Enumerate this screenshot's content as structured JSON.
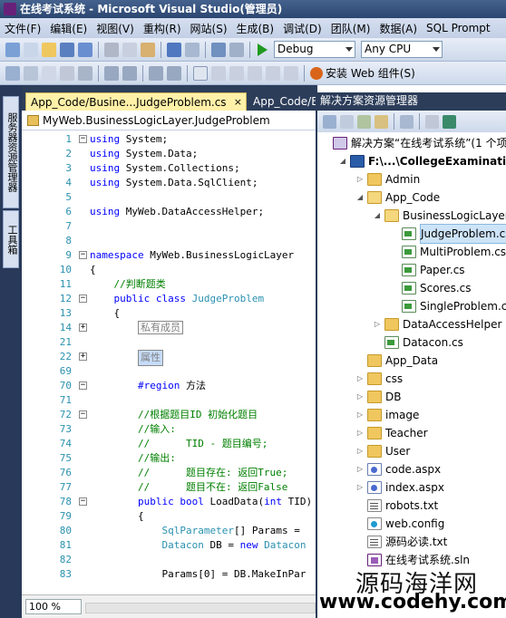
{
  "window": {
    "title": "在线考试系统 - Microsoft Visual Studio(管理员)"
  },
  "menu": [
    "文件(F)",
    "编辑(E)",
    "视图(V)",
    "重构(R)",
    "网站(S)",
    "生成(B)",
    "调试(D)",
    "团队(M)",
    "数据(A)",
    "SQL Prompt"
  ],
  "toolbar": {
    "config": "Debug",
    "platform": "Any CPU",
    "install_web": "安装 Web 组件(S)"
  },
  "side_tabs": {
    "server_explorer": "服务器资源管理器",
    "toolbox": "工具箱"
  },
  "editor": {
    "active_tab": "App_Code/Busine...JudgeProblem.cs",
    "other_tab": "App_Code/B",
    "close": "×",
    "nav": "MyWeb.BusinessLogicLayer.JudgeProblem",
    "lines": [
      {
        "n": "1",
        "f": "−",
        "t": "using System;"
      },
      {
        "n": "2",
        "f": "",
        "t": "using System.Data;"
      },
      {
        "n": "3",
        "f": "",
        "t": "using System.Collections;"
      },
      {
        "n": "4",
        "f": "",
        "t": "using System.Data.SqlClient;"
      },
      {
        "n": "5",
        "f": "",
        "t": ""
      },
      {
        "n": "6",
        "f": "",
        "t": "using MyWeb.DataAccessHelper;"
      },
      {
        "n": "7",
        "f": "",
        "t": ""
      },
      {
        "n": "8",
        "f": "",
        "t": ""
      },
      {
        "n": "9",
        "f": "−",
        "t": "namespace MyWeb.BusinessLogicLayer"
      },
      {
        "n": "10",
        "f": "",
        "t": "{"
      },
      {
        "n": "11",
        "f": "",
        "t": "    //判断题类"
      },
      {
        "n": "12",
        "f": "−",
        "t": "    public class JudgeProblem"
      },
      {
        "n": "13",
        "f": "",
        "t": "    {"
      },
      {
        "n": "14",
        "f": "+",
        "t": "        私有成员"
      },
      {
        "n": "21",
        "f": "",
        "t": ""
      },
      {
        "n": "22",
        "f": "+",
        "t": "        属性"
      },
      {
        "n": "69",
        "f": "",
        "t": ""
      },
      {
        "n": "70",
        "f": "−",
        "t": "        #region 方法"
      },
      {
        "n": "71",
        "f": "",
        "t": ""
      },
      {
        "n": "72",
        "f": "−",
        "t": "        //根据题目ID 初始化题目"
      },
      {
        "n": "73",
        "f": "",
        "t": "        //输入:"
      },
      {
        "n": "74",
        "f": "",
        "t": "        //      TID - 题目编号;"
      },
      {
        "n": "75",
        "f": "",
        "t": "        //输出:"
      },
      {
        "n": "76",
        "f": "",
        "t": "        //      题目存在: 返回True;"
      },
      {
        "n": "77",
        "f": "",
        "t": "        //      题目不在: 返回False"
      },
      {
        "n": "78",
        "f": "−",
        "t": "        public bool LoadData(int TID)"
      },
      {
        "n": "79",
        "f": "",
        "t": "        {"
      },
      {
        "n": "80",
        "f": "",
        "t": "            SqlParameter[] Params ="
      },
      {
        "n": "81",
        "f": "",
        "t": "            Datacon DB = new Datacon"
      },
      {
        "n": "82",
        "f": "",
        "t": ""
      },
      {
        "n": "83",
        "f": "",
        "t": "            Params[0] = DB.MakeInPar"
      }
    ],
    "zoom": "100 %"
  },
  "solution_explorer": {
    "title": "解决方案资源管理器",
    "items": [
      {
        "label": "解决方案“在线考试系统”(1 个项",
        "indent": 0,
        "exp": "",
        "icon": "solution-icon"
      },
      {
        "label": "F:\\...\\CollegeExamination_",
        "indent": 1,
        "exp": "◢",
        "icon": "project-icon"
      },
      {
        "label": "Admin",
        "indent": 2,
        "exp": "▷",
        "icon": "folder-icon"
      },
      {
        "label": "App_Code",
        "indent": 2,
        "exp": "◢",
        "icon": "folder-open-icon"
      },
      {
        "label": "BusinessLogicLayer",
        "indent": 3,
        "exp": "◢",
        "icon": "folder-open-icon"
      },
      {
        "label": "JudgeProblem.cs",
        "indent": 4,
        "exp": "",
        "icon": "cs-file-icon",
        "selected": true
      },
      {
        "label": "MultiProblem.cs",
        "indent": 4,
        "exp": "",
        "icon": "cs-file-icon"
      },
      {
        "label": "Paper.cs",
        "indent": 4,
        "exp": "",
        "icon": "cs-file-icon"
      },
      {
        "label": "Scores.cs",
        "indent": 4,
        "exp": "",
        "icon": "cs-file-icon"
      },
      {
        "label": "SingleProblem.cs",
        "indent": 4,
        "exp": "",
        "icon": "cs-file-icon"
      },
      {
        "label": "DataAccessHelper",
        "indent": 3,
        "exp": "▷",
        "icon": "folder-icon"
      },
      {
        "label": "Datacon.cs",
        "indent": 3,
        "exp": "",
        "icon": "cs-file-icon"
      },
      {
        "label": "App_Data",
        "indent": 2,
        "exp": "",
        "icon": "folder-icon"
      },
      {
        "label": "css",
        "indent": 2,
        "exp": "▷",
        "icon": "folder-icon"
      },
      {
        "label": "DB",
        "indent": 2,
        "exp": "▷",
        "icon": "folder-icon"
      },
      {
        "label": "image",
        "indent": 2,
        "exp": "▷",
        "icon": "folder-icon"
      },
      {
        "label": "Teacher",
        "indent": 2,
        "exp": "▷",
        "icon": "folder-icon"
      },
      {
        "label": "User",
        "indent": 2,
        "exp": "▷",
        "icon": "folder-icon"
      },
      {
        "label": "code.aspx",
        "indent": 2,
        "exp": "▷",
        "icon": "aspx-icon"
      },
      {
        "label": "index.aspx",
        "indent": 2,
        "exp": "▷",
        "icon": "aspx-icon"
      },
      {
        "label": "robots.txt",
        "indent": 2,
        "exp": "",
        "icon": "text-file-icon"
      },
      {
        "label": "web.config",
        "indent": 2,
        "exp": "",
        "icon": "config-file-icon"
      },
      {
        "label": "源码必读.txt",
        "indent": 2,
        "exp": "",
        "icon": "text-file-icon"
      },
      {
        "label": "在线考试系统.sln",
        "indent": 2,
        "exp": "",
        "icon": "sln-file-icon"
      }
    ]
  },
  "watermark": {
    "line1": "源码海洋网",
    "line2": "www.codehy.com"
  },
  "colors": {
    "accent": "#2c3d5a",
    "tab_active": "#fff1a8",
    "keyword": "#0000ff",
    "comment": "#008000",
    "type": "#2b91af",
    "line_number": "#2b91af"
  }
}
